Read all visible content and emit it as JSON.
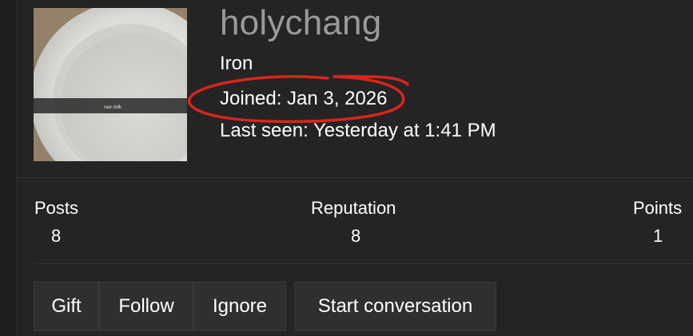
{
  "profile": {
    "username": "holychang",
    "user_title": "Iron",
    "joined": "Joined: Jan 3, 2026",
    "last_seen": "Last seen: Yesterday at 1:41 PM",
    "avatar_label": "raw milk"
  },
  "stats": [
    {
      "label": "Posts",
      "value": "8"
    },
    {
      "label": "Reputation",
      "value": "8"
    },
    {
      "label": "Points",
      "value": "1"
    }
  ],
  "actions": {
    "gift": "Gift",
    "follow": "Follow",
    "ignore": "Ignore",
    "start_conversation": "Start conversation"
  },
  "colors": {
    "background": "#242424",
    "annotation": "#d8261c",
    "username": "#9a9a9a",
    "button_bg": "#2f2f2f"
  }
}
